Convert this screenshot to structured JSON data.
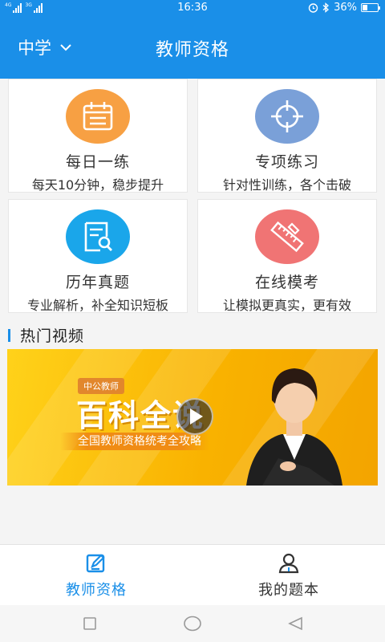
{
  "status_bar": {
    "time": "16:36",
    "battery_percent": "36%",
    "battery_level": 0.36,
    "sim1_label": "4G",
    "sim2_label": "3G",
    "icons": [
      "signal-icon",
      "alarm-icon",
      "bluetooth-icon",
      "battery-icon"
    ]
  },
  "header": {
    "level_selector": "中学",
    "title": "教师资格",
    "background": "#1a8fe8"
  },
  "cards": [
    {
      "title": "每日一练",
      "desc": "每天10分钟，稳步提升",
      "icon": "calendar-icon",
      "color": "#f7a043"
    },
    {
      "title": "专项练习",
      "desc": "针对性训练，各个击破",
      "icon": "crosshair-icon",
      "color": "#7aa0d8"
    },
    {
      "title": "历年真题",
      "desc": "专业解析，补全知识短板",
      "icon": "document-search-icon",
      "color": "#1aa6ea"
    },
    {
      "title": "在线模考",
      "desc": "让模拟更真实，更有效",
      "icon": "ruler-pencil-icon",
      "color": "#f07474"
    }
  ],
  "hot_video": {
    "section_title": "热门视频",
    "brand_tag": "中公教师",
    "banner_title": "百科全说",
    "banner_subtitle": "全国教师资格统考全攻略"
  },
  "bottom_nav": {
    "items": [
      {
        "label": "教师资格",
        "icon": "edit-icon",
        "active": true
      },
      {
        "label": "我的题本",
        "icon": "user-icon",
        "active": false
      }
    ],
    "active_color": "#1a8fe8"
  },
  "system_nav": [
    "square-icon",
    "circle-icon",
    "triangle-back-icon"
  ]
}
